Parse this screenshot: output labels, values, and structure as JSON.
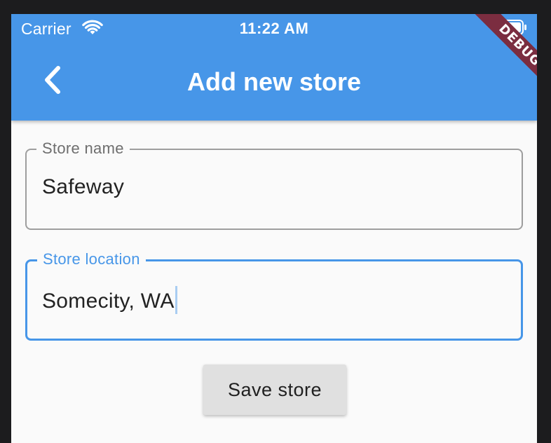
{
  "status_bar": {
    "carrier": "Carrier",
    "time": "11:22 AM",
    "wifi_icon": "wifi-icon",
    "battery_icon": "battery-icon"
  },
  "app_bar": {
    "title": "Add new store",
    "back_icon": "chevron-left-icon",
    "background_color": "#4796e8"
  },
  "debug_banner": {
    "label": "DEBUG",
    "color": "#7b2d40"
  },
  "form": {
    "store_name": {
      "label": "Store name",
      "value": "Safeway"
    },
    "store_location": {
      "label": "Store location",
      "value": "Somecity, WA",
      "focused": true,
      "focus_color": "#4796e8"
    },
    "save_button": {
      "label": "Save store"
    }
  }
}
